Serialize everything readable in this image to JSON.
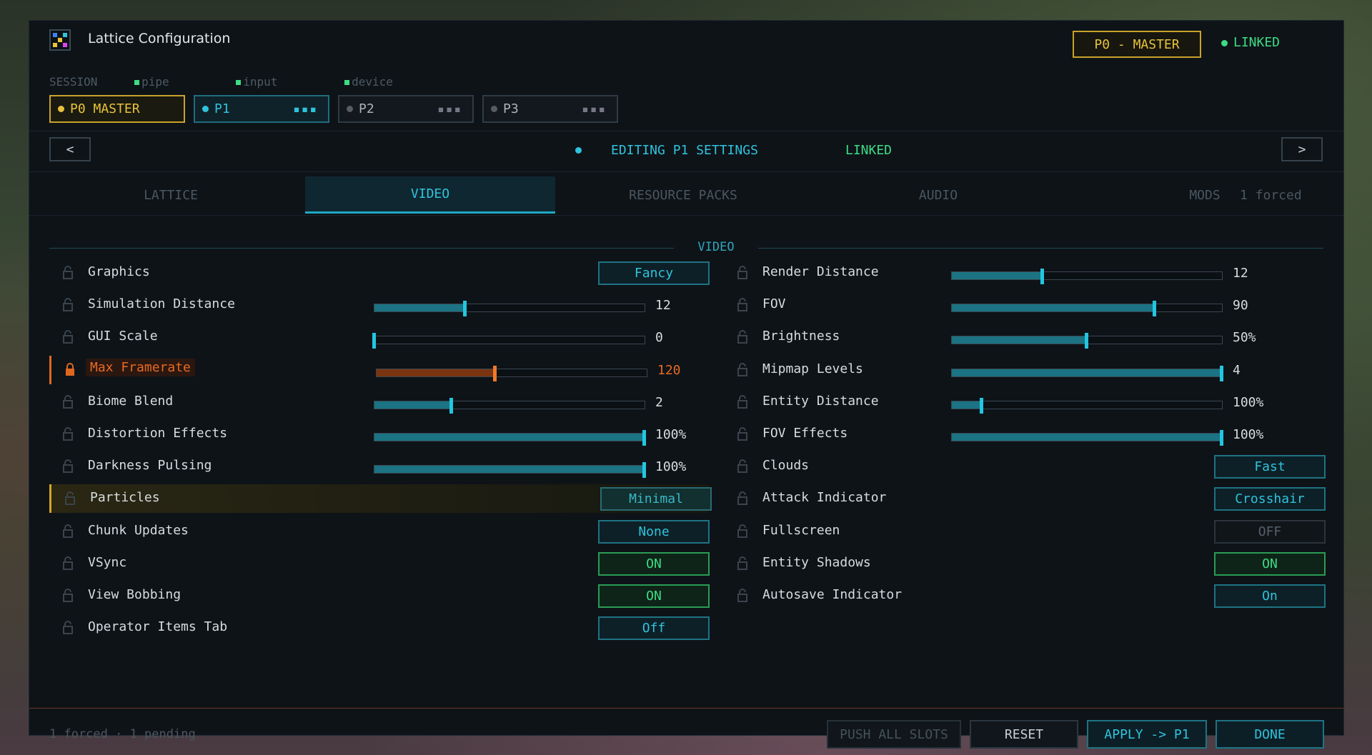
{
  "window": {
    "title": "Lattice Configuration",
    "master_badge": "P0 - MASTER",
    "link_status": "LINKED"
  },
  "session": {
    "label": "SESSION",
    "indicators": [
      "pipe",
      "input",
      "device"
    ],
    "slots": [
      {
        "label": "P0 MASTER",
        "dot": "#e8c23a",
        "state": "master"
      },
      {
        "label": "P1",
        "dot": "#2fc3dd",
        "state": "active"
      },
      {
        "label": "P2",
        "dot": "#555c62",
        "state": "idle"
      },
      {
        "label": "P3",
        "dot": "#555c62",
        "state": "idle"
      }
    ]
  },
  "edit_bar": {
    "prev": "<",
    "next": ">",
    "label": "EDITING P1 SETTINGS",
    "linked": "LINKED"
  },
  "tabs": [
    {
      "label": "LATTICE"
    },
    {
      "label": "VIDEO",
      "active": true
    },
    {
      "label": "RESOURCE PACKS"
    },
    {
      "label": "AUDIO"
    },
    {
      "label": "MODS"
    }
  ],
  "tabs_note": "1 forced",
  "section": {
    "title": "VIDEO"
  },
  "settings_left": [
    {
      "label": "Graphics",
      "type": "button",
      "value": "Fancy"
    },
    {
      "label": "Simulation Distance",
      "type": "slider",
      "value": "12",
      "level": 0.335
    },
    {
      "label": "GUI Scale",
      "type": "slider",
      "value": "0",
      "level": 0.0
    },
    {
      "label": "Max Framerate",
      "type": "slider",
      "value": "120",
      "level": 0.44,
      "locked": true
    },
    {
      "label": "Biome Blend",
      "type": "slider",
      "value": "2",
      "level": 0.285
    },
    {
      "label": "Distortion Effects",
      "type": "slider",
      "value": "100%",
      "level": 1.0
    },
    {
      "label": "Darkness Pulsing",
      "type": "slider",
      "value": "100%",
      "level": 1.0
    },
    {
      "label": "Particles",
      "type": "button",
      "value": "Minimal",
      "highlight": true
    },
    {
      "label": "Chunk Updates",
      "type": "button",
      "value": "None"
    },
    {
      "label": "VSync",
      "type": "toggle",
      "value": "ON"
    },
    {
      "label": "View Bobbing",
      "type": "toggle",
      "value": "ON"
    },
    {
      "label": "Operator Items Tab",
      "type": "button",
      "value": "Off"
    }
  ],
  "settings_right": [
    {
      "label": "Render Distance",
      "type": "slider",
      "value": "12",
      "level": 0.335
    },
    {
      "label": "FOV",
      "type": "slider",
      "value": "90",
      "level": 0.75
    },
    {
      "label": "Brightness",
      "type": "slider",
      "value": "50%",
      "level": 0.5
    },
    {
      "label": "Mipmap Levels",
      "type": "slider",
      "value": "4",
      "level": 1.0
    },
    {
      "label": "Entity Distance",
      "type": "slider",
      "value": "100%",
      "level": 0.11
    },
    {
      "label": "FOV Effects",
      "type": "slider",
      "value": "100%",
      "level": 1.0
    },
    {
      "label": "Clouds",
      "type": "button",
      "value": "Fast"
    },
    {
      "label": "Attack Indicator",
      "type": "button",
      "value": "Crosshair"
    },
    {
      "label": "Fullscreen",
      "type": "disabled",
      "value": "OFF"
    },
    {
      "label": "Entity Shadows",
      "type": "toggle",
      "value": "ON"
    },
    {
      "label": "Autosave Indicator",
      "type": "button",
      "value": "On"
    }
  ],
  "footer": {
    "note": "1 forced · 1 pending",
    "buttons": [
      "PUSH ALL SLOTS",
      "RESET",
      "APPLY -> P1",
      "DONE"
    ]
  },
  "colors": {
    "accent": "#2fc3dd",
    "master": "#e8c23a",
    "linked": "#3ddc84",
    "locked": "#e0661e"
  }
}
